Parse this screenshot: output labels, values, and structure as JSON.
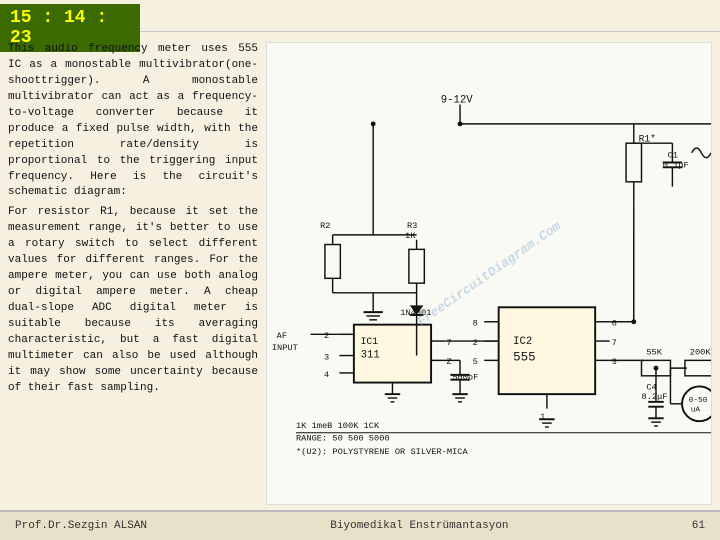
{
  "header": {
    "time": "15 : 14 : 23"
  },
  "text": {
    "body": "This audio frequency meter uses 555 IC as a monostable multivibrator(one-shoottrigger). A monostable multivibrator can act as a frequency-to-voltage converter because it produce a fixed pulse width, with the repetition rate/density is proportional to the triggering input frequency. Here is the circuit's schematic diagram:",
    "r1_note": "For resistor R1, because it set the measurement range, it's better to use a rotary switch to select different values for different ranges. For the ampere meter, you can use both analog or digital ampere meter. A cheap dual-slope ADC digital meter is suitable because its averaging characteristic, but a fast digital multimeter can also be used although it may show some uncertainty because of their fast sampling."
  },
  "footer": {
    "author": "Prof.Dr.Sezgin ALSAN",
    "subject": "Biyomedikal Enstrümantasyon",
    "page": "61"
  },
  "diagram": {
    "watermark": "FreeCircuitDiagram.Com",
    "voltage": "9-12V",
    "components": {
      "r1": "R1*",
      "r2": "R2",
      "r3": "R3 1K",
      "r4": "55K",
      "r5": "200K",
      "c1": "C1 0.1μF",
      "c2": "500pF",
      "c3": "C4 8.2μF",
      "diode": "1N4001",
      "ic1": "IC1 311",
      "ic2": "IC2 555",
      "meter": "0-50uA",
      "input": "INPUT",
      "range": "RANGE: 50  500  5000",
      "values": "1K  1meB  100K  1CK",
      "note": "*(U2): POLYSTYRENE OR SILVER-MICA"
    }
  }
}
